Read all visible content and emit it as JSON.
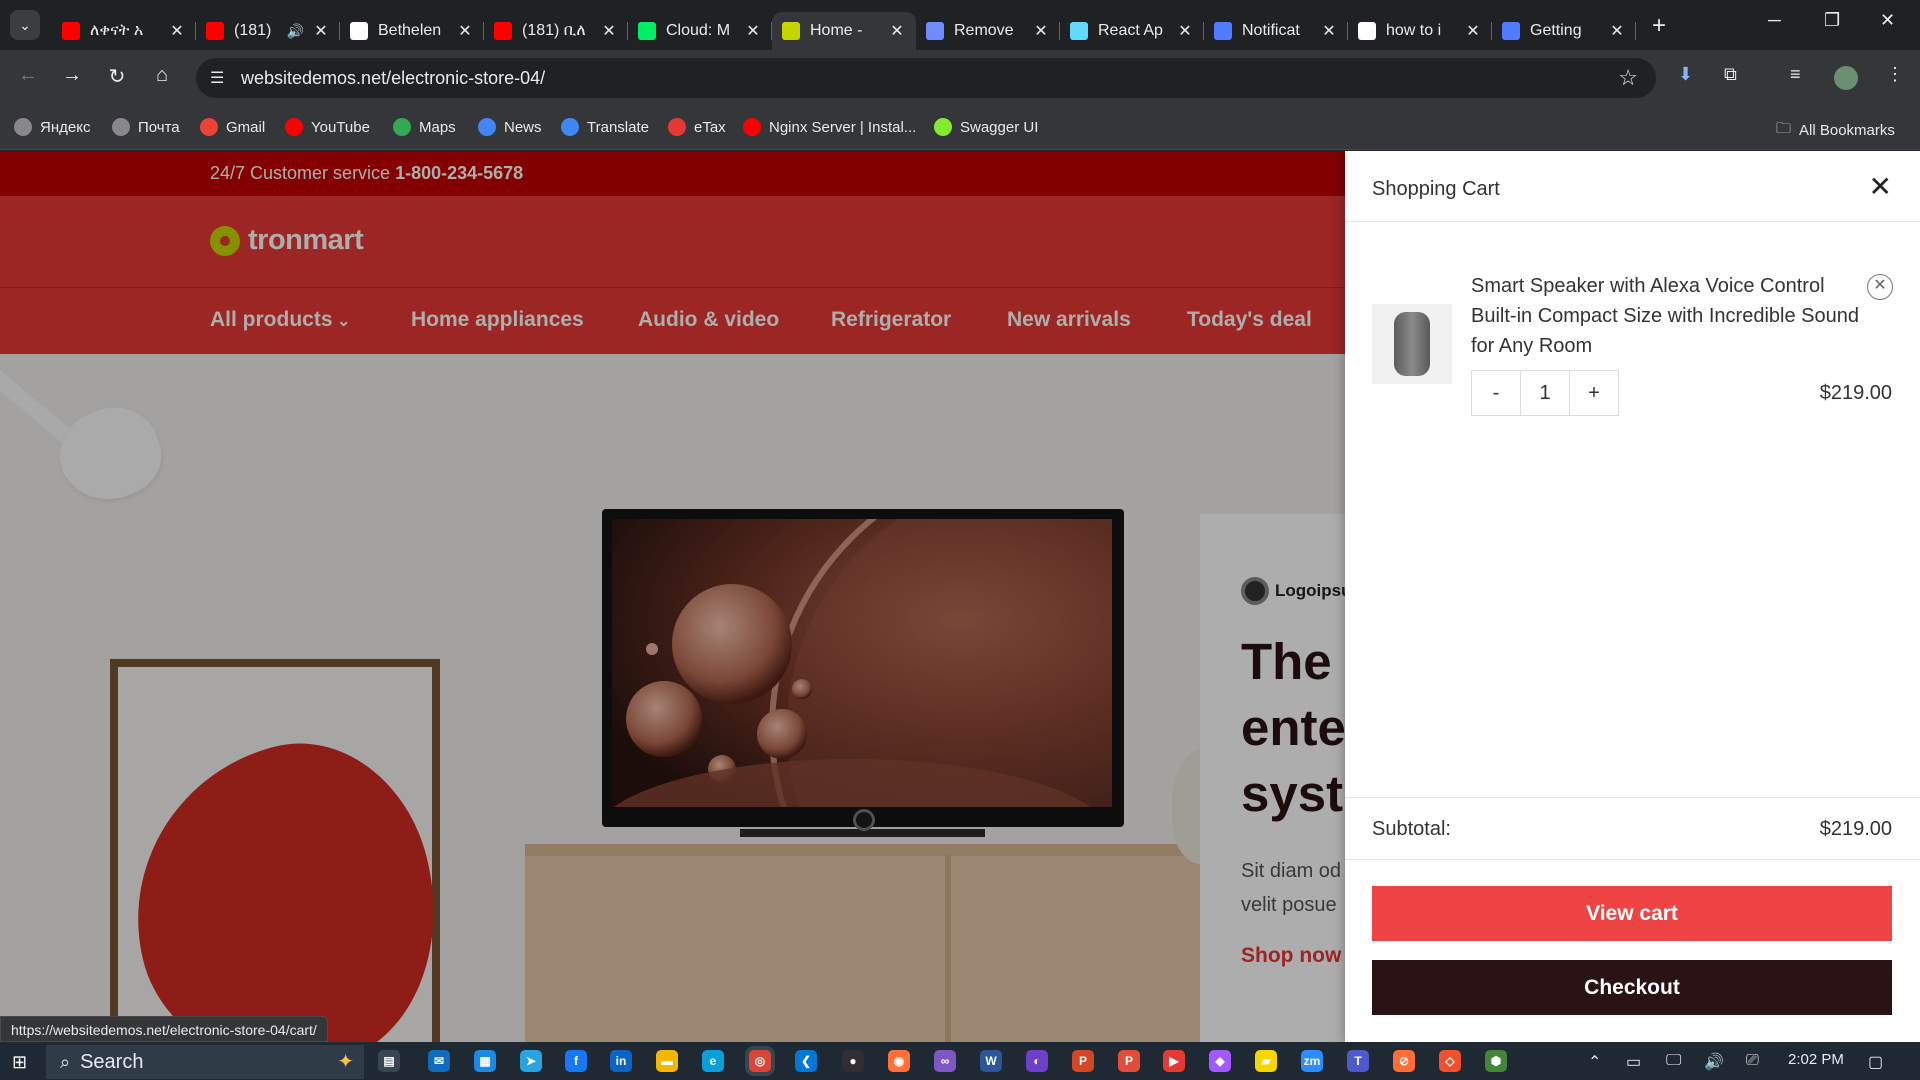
{
  "browser": {
    "tabs": [
      {
        "title": "ለቀናት አ",
        "icon": "youtube-icon",
        "color": "#ff0000"
      },
      {
        "title": "(181)",
        "icon": "youtube-icon",
        "color": "#ff0000",
        "audio": true
      },
      {
        "title": "Bethelen",
        "icon": "github-icon",
        "color": "#ffffff"
      },
      {
        "title": "(181) ቢለ",
        "icon": "youtube-icon",
        "color": "#ff0000"
      },
      {
        "title": "Cloud: M",
        "icon": "mongodb-leaf-icon",
        "color": "#00ed64"
      },
      {
        "title": "Home - ",
        "icon": "tronmart-icon",
        "color": "#c7d600",
        "active": true
      },
      {
        "title": "Remove",
        "icon": "triangle-logo-icon",
        "color": "#6c8cff"
      },
      {
        "title": "React Ap",
        "icon": "react-icon",
        "color": "#61dafb"
      },
      {
        "title": "Notificat",
        "icon": "diamond-logo-icon",
        "color": "#4f7cff"
      },
      {
        "title": "how to i",
        "icon": "google-icon",
        "color": "#ffffff"
      },
      {
        "title": "Getting ",
        "icon": "diamond-logo-icon",
        "color": "#4f7cff"
      }
    ],
    "url": "websitedemos.net/electronic-store-04/",
    "bookmarks": [
      {
        "label": "Яндекс",
        "icon": "globe-icon",
        "color": "#888"
      },
      {
        "label": "Почта",
        "icon": "globe-icon",
        "color": "#888"
      },
      {
        "label": "Gmail",
        "icon": "google-icon",
        "color": "#ea4335"
      },
      {
        "label": "YouTube",
        "icon": "youtube-icon",
        "color": "#ff0000"
      },
      {
        "label": "Maps",
        "icon": "maps-icon",
        "color": "#34a853"
      },
      {
        "label": "News",
        "icon": "news-icon",
        "color": "#4285f4"
      },
      {
        "label": "Translate",
        "icon": "translate-icon",
        "color": "#4285f4"
      },
      {
        "label": "eTax",
        "icon": "etax-icon",
        "color": "#e53935"
      },
      {
        "label": "Nginx Server | Instal...",
        "icon": "youtube-icon",
        "color": "#ff0000"
      },
      {
        "label": "Swagger UI",
        "icon": "swagger-icon",
        "color": "#85ea2d"
      }
    ],
    "all_bookmarks": "All Bookmarks",
    "status_url": "https://websitedemos.net/electronic-store-04/cart/"
  },
  "site": {
    "service_label": "24/7 Customer service",
    "phone": "1-800-234-5678",
    "logo": "tronmart",
    "nav": [
      "All products",
      "Home appliances",
      "Audio & video",
      "Refrigerator",
      "New arrivals",
      "Today's deal"
    ],
    "promo": {
      "brand": "Logoipsu",
      "heading": "The\nente\nsyst",
      "body": "Sit diam od\nvelit posue",
      "link": "Shop now"
    }
  },
  "cart": {
    "title": "Shopping Cart",
    "item": {
      "name": "Smart Speaker with Alexa Voice Control Built-in Compact Size with Incredible Sound for Any Room",
      "qty": "1",
      "minus": "-",
      "plus": "+",
      "price": "$219.00"
    },
    "subtotal_label": "Subtotal:",
    "subtotal_value": "$219.00",
    "view_cart": "View cart",
    "checkout": "Checkout"
  },
  "taskbar": {
    "search_placeholder": "Search",
    "time": "2:02 PM"
  },
  "colors": {
    "brand_red": "#e53935",
    "topbar_red": "#c00000",
    "checkout_dark": "#2a1215",
    "view_cart_red": "#ef4444"
  }
}
